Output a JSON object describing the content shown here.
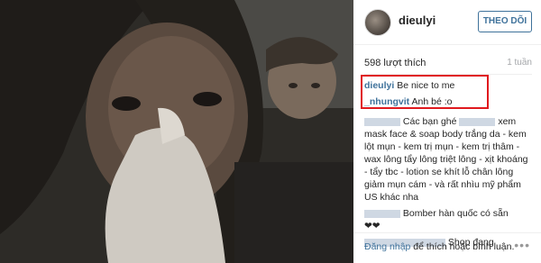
{
  "post": {
    "username": "dieulyi",
    "follow_label": "THEO DÕI",
    "likes": "598 lượt thích",
    "time_ago": "1 tuần"
  },
  "comments": [
    {
      "user": "dieulyi",
      "text": "Be nice to me"
    },
    {
      "user": "_nhungvit",
      "text": "Anh bé :o"
    }
  ],
  "promo": {
    "line1": "Các bạn ghé",
    "line2": "xem mask face & soap body trắng da - kem lột mụn - kem trị mụn - kem trị thâm - wax lông tẩy lông triệt lông - xịt khoáng - tẩy tbc - lotion se khít lỗ chân lông giảm mụn cám - và rất nhìu mỹ phẩm US khác nha",
    "line3": "Bomber hàn quốc có sẵn",
    "hearts": "❤❤",
    "line4": "Shop đang"
  },
  "footer": {
    "login": "Đăng nhập",
    "rest": " để thích hoặc bình luận.",
    "more": "•••"
  }
}
